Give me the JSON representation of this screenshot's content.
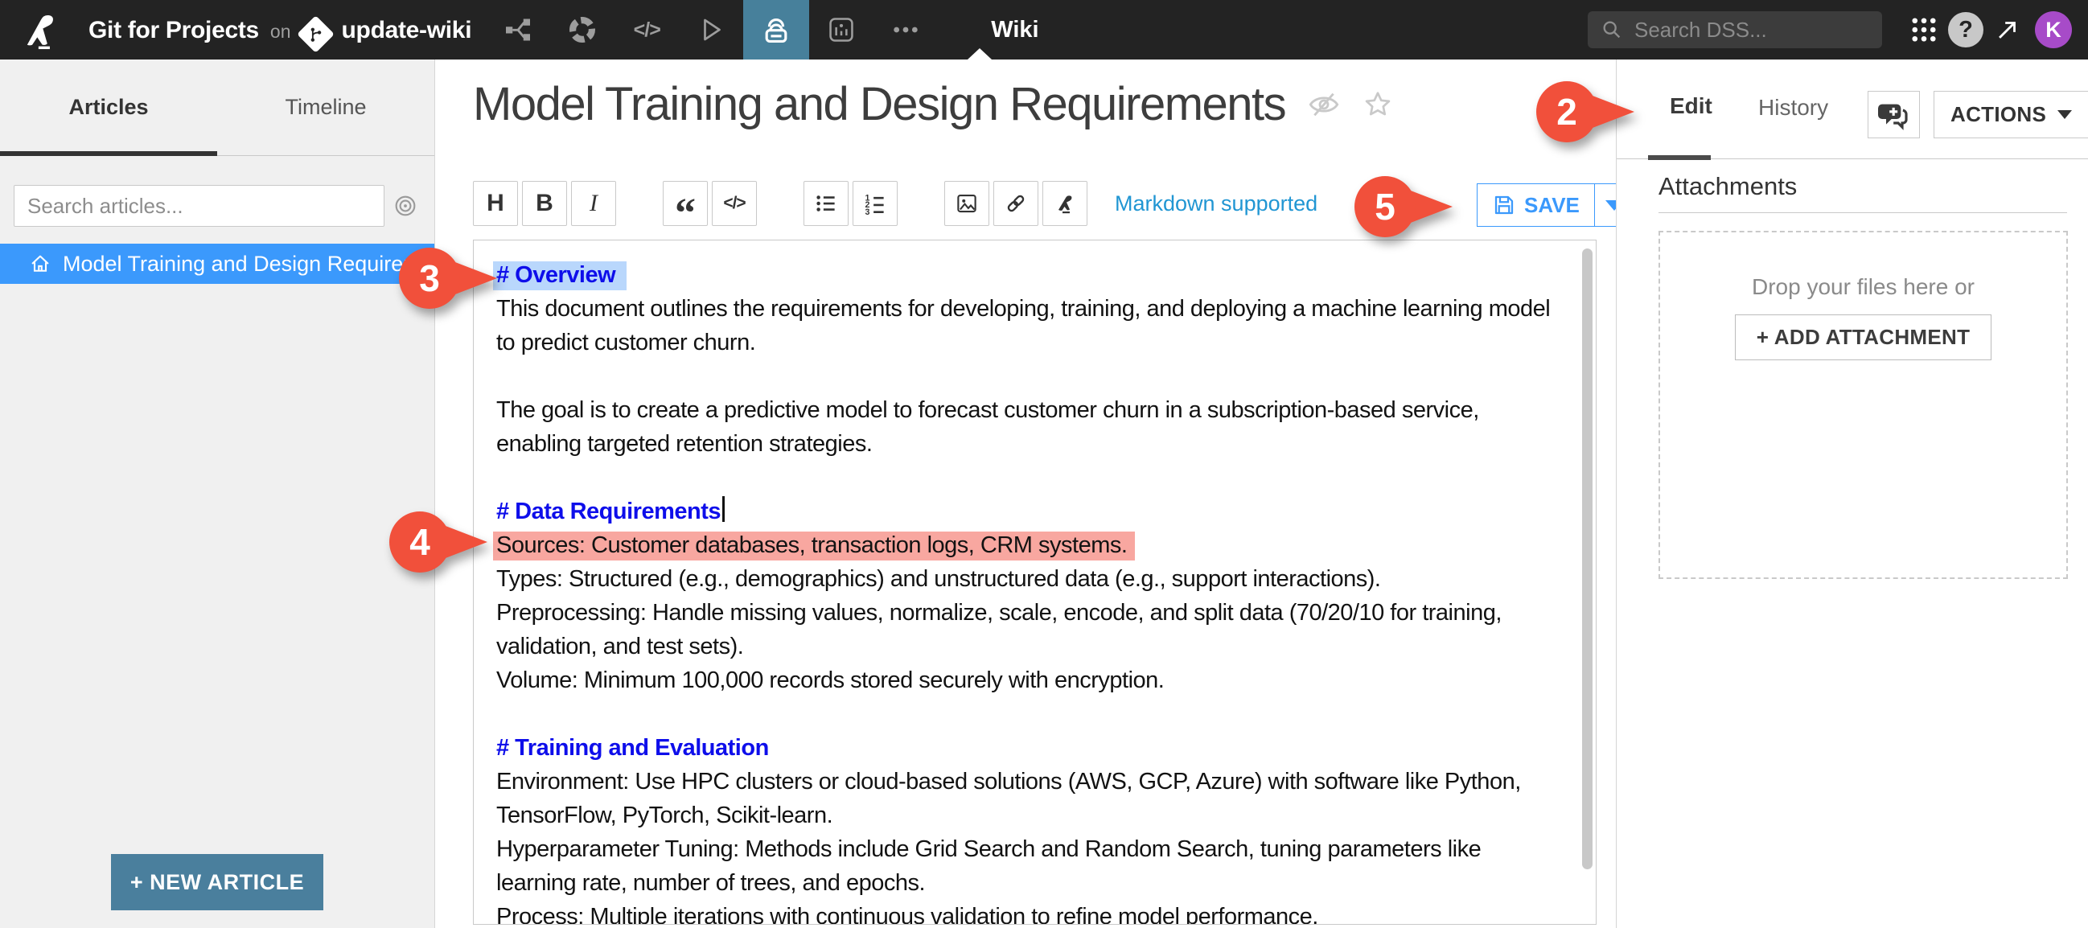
{
  "nav": {
    "project_name": "Git for Projects",
    "on_label": "on",
    "branch_name": "update-wiki",
    "page_label": "Wiki",
    "search_placeholder": "Search DSS...",
    "avatar_initial": "K",
    "help_glyph": "?"
  },
  "sidebar": {
    "tab_articles": "Articles",
    "tab_timeline": "Timeline",
    "search_placeholder": "Search articles...",
    "selected_article_label": "Model Training and Design Requirements",
    "new_article_label": "+ NEW ARTICLE"
  },
  "article": {
    "title": "Model Training and Design Requirements"
  },
  "toolbar": {
    "heading_label": "H",
    "bold_label": "B",
    "italic_label": "I",
    "quote_label": "“",
    "code_label": "</>",
    "markdown_note": "Markdown supported",
    "save_label": "SAVE"
  },
  "panel": {
    "edit_label": "Edit",
    "history_label": "History",
    "actions_label": "ACTIONS",
    "attachments_title": "Attachments",
    "drop_text": "Drop your files here or",
    "add_attachment_label": "+ ADD ATTACHMENT"
  },
  "callouts": {
    "c2": "2",
    "c3": "3",
    "c4": "4",
    "c5": "5"
  },
  "editor": {
    "lines": [
      {
        "type": "heading",
        "text": "# Overview",
        "highlight": "selection"
      },
      {
        "type": "text",
        "text": "This document outlines the requirements for developing, training, and deploying a machine learning model to predict customer churn."
      },
      {
        "type": "blank"
      },
      {
        "type": "text",
        "text": "The goal is to create a predictive model to forecast customer churn in a subscription-based service, enabling targeted retention strategies."
      },
      {
        "type": "blank"
      },
      {
        "type": "heading",
        "text": "# Data Requirements",
        "caret": true
      },
      {
        "type": "text",
        "text": "Sources: Customer databases, transaction logs, CRM systems.",
        "highlight": "red"
      },
      {
        "type": "text",
        "text": "Types: Structured (e.g., demographics) and unstructured data (e.g., support interactions)."
      },
      {
        "type": "text",
        "text": "Preprocessing: Handle missing values, normalize, scale, encode, and split data (70/20/10 for training, validation, and test sets)."
      },
      {
        "type": "text",
        "text": "Volume: Minimum 100,000 records stored securely with encryption."
      },
      {
        "type": "blank"
      },
      {
        "type": "heading",
        "text": "# Training and Evaluation"
      },
      {
        "type": "text",
        "text": "Environment: Use HPC clusters or cloud-based solutions (AWS, GCP, Azure) with software like Python, TensorFlow, PyTorch, Scikit-learn."
      },
      {
        "type": "text",
        "text": "Hyperparameter Tuning: Methods include Grid Search and Random Search, tuning parameters like learning rate, number of trees, and epochs."
      },
      {
        "type": "text",
        "text": "Process: Multiple iterations with continuous validation to refine model performance."
      }
    ]
  },
  "colors": {
    "nav_background": "#232323",
    "active_nav_tab": "#47809b",
    "selected_row_blue": "#3b99fc",
    "save_blue": "#3b99fc",
    "link_blue": "#2196d3",
    "heading_blue": "#0e0eea",
    "selection_highlight": "#b9d7fc",
    "red_highlight": "#f8a7a0",
    "callout_red": "#f1503b",
    "new_article_button": "#4a7f9d",
    "avatar_purple": "#a74bc8"
  }
}
